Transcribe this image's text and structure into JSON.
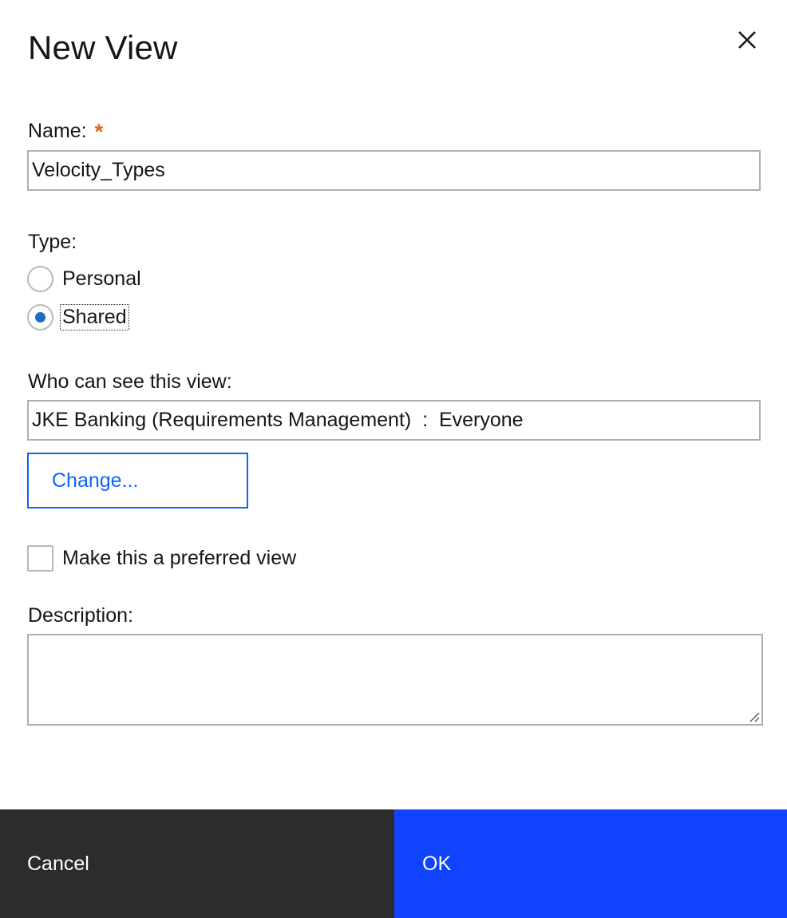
{
  "dialog": {
    "title": "New View",
    "close_icon": "close-icon"
  },
  "name_field": {
    "label": "Name:",
    "required_marker": "*",
    "value": "Velocity_Types"
  },
  "type_field": {
    "label": "Type:",
    "options": [
      {
        "label": "Personal",
        "checked": false
      },
      {
        "label": "Shared",
        "checked": true
      }
    ]
  },
  "visibility": {
    "label": "Who can see this view:",
    "value": "JKE Banking (Requirements Management)  :  Everyone",
    "change_label": "Change..."
  },
  "preferred": {
    "label": "Make this a preferred view",
    "checked": false
  },
  "description": {
    "label": "Description:",
    "value": ""
  },
  "footer": {
    "cancel_label": "Cancel",
    "ok_label": "OK"
  },
  "colors": {
    "primary": "#0f44fc",
    "link": "#0f62fe",
    "secondary": "#2b2c2c",
    "required": "#e0620f",
    "radio_selected": "#1a6fc2"
  }
}
